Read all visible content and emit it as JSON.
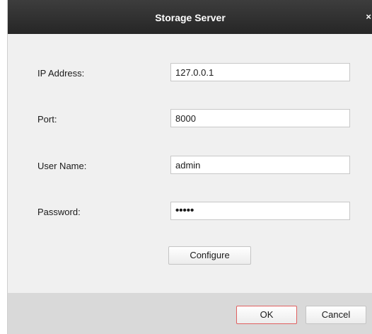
{
  "window": {
    "title": "Storage Server",
    "close_glyph": "×"
  },
  "form": {
    "ip_label": "IP Address:",
    "ip_value": "127.0.0.1",
    "port_label": "Port:",
    "port_value": "8000",
    "username_label": "User Name:",
    "username_value": "admin",
    "password_label": "Password:",
    "password_value": "•••••"
  },
  "buttons": {
    "configure": "Configure",
    "ok": "OK",
    "cancel": "Cancel"
  },
  "colors": {
    "titlebar": "#2e2e2e",
    "dialog_bg": "#f0f0f0",
    "footer_bg": "#d9d9d9",
    "ok_border": "#e06060"
  }
}
